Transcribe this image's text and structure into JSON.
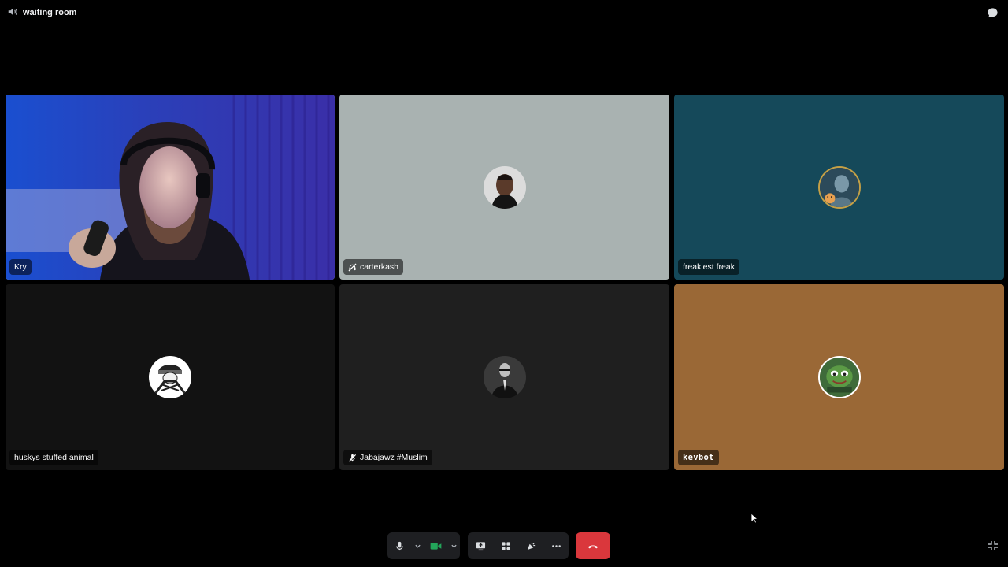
{
  "channel": {
    "name": "waiting room",
    "icon": "speaker-icon"
  },
  "topbar": {
    "chat_icon": "chat-bubble-icon"
  },
  "participants": [
    {
      "name": "Kry",
      "tile_color": "#2a2f8a",
      "video_on": true,
      "speaking": true,
      "muted": false
    },
    {
      "name": "carterkash",
      "tile_color": "#a9b2b1",
      "video_on": false,
      "muted": false,
      "deafened": true,
      "status_icon": "deafened-icon"
    },
    {
      "name": "freakiest freak",
      "tile_color": "#15495a",
      "video_on": false,
      "muted": false
    },
    {
      "name": "huskys stuffed animal",
      "tile_color": "#121212",
      "video_on": false,
      "muted": false
    },
    {
      "name": "Jabajawz #Muslim",
      "tile_color": "#1f1f1f",
      "video_on": false,
      "muted": true,
      "status_icon": "mic-muted-icon"
    },
    {
      "name": "kevbot",
      "tile_color": "#9a6836",
      "video_on": false,
      "muted": false
    }
  ],
  "controls": {
    "mic_icon": "microphone-icon",
    "camera_icon": "camera-icon",
    "share_icon": "screen-share-icon",
    "activities_icon": "activities-icon",
    "soundboard_icon": "soundboard-icon",
    "more_icon": "more-icon",
    "hangup_icon": "hang-up-icon",
    "camera_color": "#23a55a",
    "hangup_color": "#da373c",
    "fullscreen_icon": "exit-fullscreen-icon"
  }
}
